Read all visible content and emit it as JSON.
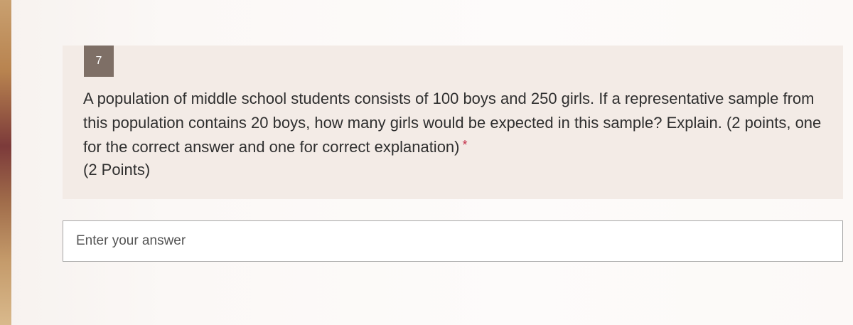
{
  "question": {
    "number": "7",
    "text": "A population of middle school students consists of 100 boys and 250 girls.  If a representative sample from this population contains 20 boys, how many girls would be expected in this sample? Explain. (2 points, one for the correct answer and one for correct explanation)",
    "required_marker": "*",
    "points": "(2 Points)"
  },
  "answer": {
    "placeholder": "Enter your answer",
    "value": ""
  },
  "colors": {
    "number_badge": "#7e6f66",
    "card_background": "#f3ebe6",
    "required": "#c4314b"
  }
}
